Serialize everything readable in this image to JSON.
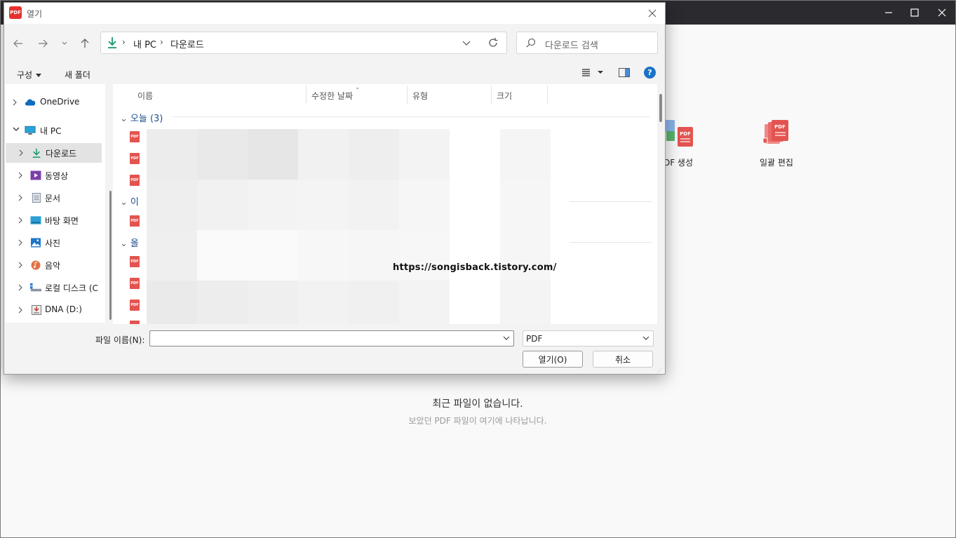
{
  "app": {
    "tools": [
      {
        "label": "DF 생성",
        "icon": "pdf-create-icon"
      },
      {
        "label": "일괄 편집",
        "icon": "batch-edit-icon"
      }
    ],
    "empty_title": "최근 파일이 없습니다.",
    "empty_subtitle": "보았던 PDF 파일이 여기에 나타납니다."
  },
  "dialog": {
    "title": "열기",
    "logo_text": "PDF",
    "breadcrumb": [
      "내 PC",
      "다운로드"
    ],
    "search_placeholder": "다운로드 검색",
    "commands": {
      "organize": "구성",
      "new_folder": "새 폴더"
    },
    "help": "?",
    "tree": [
      {
        "label": "OneDrive",
        "icon": "onedrive-icon"
      },
      {
        "label": "내 PC",
        "icon": "pc-icon"
      },
      {
        "label": "다운로드",
        "icon": "download-icon"
      },
      {
        "label": "동영상",
        "icon": "video-icon"
      },
      {
        "label": "문서",
        "icon": "document-icon"
      },
      {
        "label": "바탕 화면",
        "icon": "desktop-icon"
      },
      {
        "label": "사진",
        "icon": "picture-icon"
      },
      {
        "label": "음악",
        "icon": "music-icon"
      },
      {
        "label": "로컬 디스크 (C",
        "icon": "local-disk-icon"
      },
      {
        "label": "DNA (D:)",
        "icon": "drive-icon"
      }
    ],
    "columns": [
      "이름",
      "수정한 날짜",
      "유형",
      "크기"
    ],
    "groups": [
      {
        "label": "오늘 (3)"
      },
      {
        "label": "이"
      },
      {
        "label": "올"
      }
    ],
    "file_icon_text": "PDF",
    "filename_label": "파일 이름(N):",
    "filename_value": "",
    "filetype": "PDF",
    "open_button": "열기(O)",
    "cancel_button": "취소"
  },
  "watermark": "https://songisback.tistory.com/"
}
